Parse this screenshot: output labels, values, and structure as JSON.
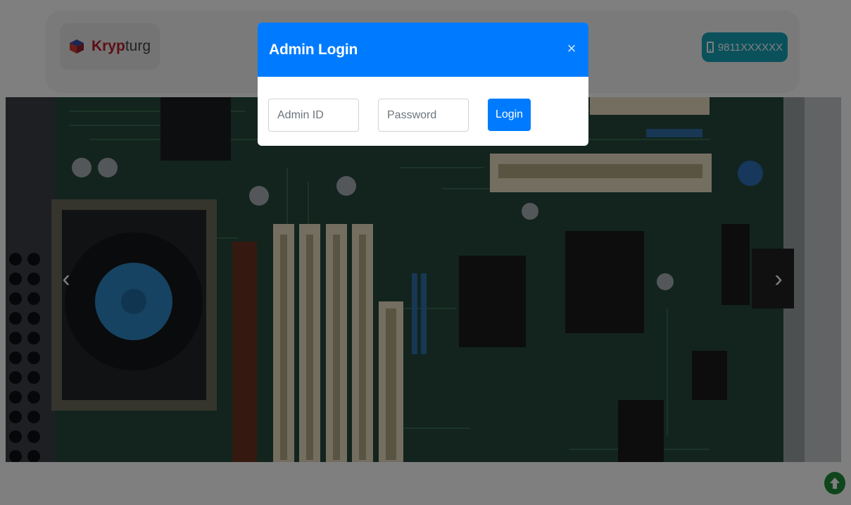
{
  "navbar": {
    "brand_strong": "Kryp",
    "brand_light": "turg",
    "brand_icon": "cube-logo-icon",
    "phone": "9811XXXXXX",
    "phone_icon": "mobile-phone-icon"
  },
  "carousel": {
    "prev_icon": "chevron-left-icon",
    "next_icon": "chevron-right-icon",
    "prev_glyph": "‹",
    "next_glyph": "›"
  },
  "modal": {
    "title": "Admin Login",
    "close_glyph": "×",
    "admin_id_placeholder": "Admin ID",
    "password_placeholder": "Password",
    "login_label": "Login"
  },
  "scroll_top": {
    "icon": "arrow-up-circle-icon"
  },
  "colors": {
    "modal_header": "#007bff",
    "login_button": "#007bff",
    "phone_button": "#17a2b8",
    "brand_red": "#b81c2c",
    "scroll_top": "#1e8a3a"
  }
}
